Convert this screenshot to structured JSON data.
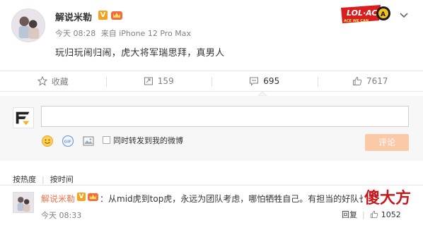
{
  "post": {
    "author": "解说米勒",
    "verified_mark": "V",
    "time": "今天 08:28",
    "source": "来自 iPhone 12 Pro Max",
    "text": "玩归玩闹归闹，虎大将军瑞思拜，真男人",
    "logo_text": "ACE WE CAN"
  },
  "actions": {
    "favorite_label": "收藏",
    "repost_count": "159",
    "comment_count": "695",
    "like_count": "7617"
  },
  "comment_box": {
    "input_value": "",
    "sync_repost_label": "同时转发到我的微博",
    "submit_label": "评论"
  },
  "sort": {
    "by_hot": "按热度",
    "by_time": "按时间"
  },
  "comment": {
    "author": "解说米勒",
    "verified_mark": "V",
    "text": "：从mid虎到top虎，永远为团队考虑，哪怕牺牲自己。有担当的好队长",
    "time": "今天 08:33",
    "reply_label": "回复",
    "like_count": "1052"
  },
  "watermark": "傻大方",
  "colors": {
    "accent": "#eb7350",
    "verified": "#f7a11a",
    "submit_disabled": "#fbc8a8",
    "watermark": "#c8161d"
  }
}
